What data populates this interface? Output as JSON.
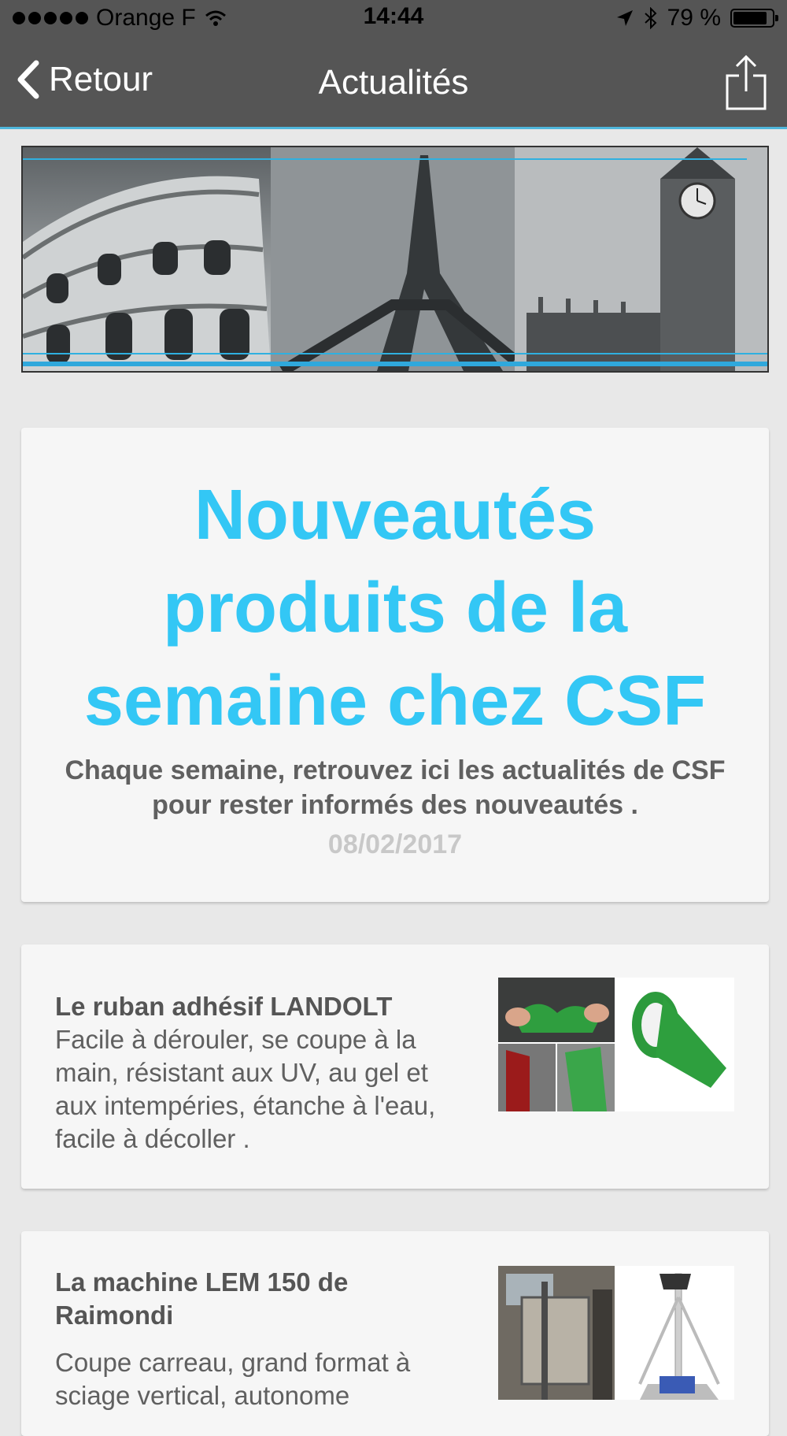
{
  "status_bar": {
    "carrier": "Orange F",
    "time": "14:44",
    "battery": "79 %"
  },
  "nav": {
    "back_label": "Retour",
    "title": "Actualités"
  },
  "hero": {
    "title": "Nouveautés produits de la semaine chez CSF",
    "description": "Chaque semaine, retrouvez ici les actualités de CSF pour rester informés des nouveautés .",
    "date": "08/02/2017"
  },
  "news": [
    {
      "title": "Le ruban adhésif LANDOLT",
      "text": "Facile à dérouler, se coupe à la main, résistant aux UV, au gel et aux intempéries, étanche à l'eau, facile à décoller ."
    },
    {
      "title": "La machine LEM 150 de Raimondi",
      "text": "Coupe carreau, grand format à sciage vertical, autonome"
    }
  ],
  "colors": {
    "accent": "#33c7f5",
    "bar": "#555555",
    "separator": "#4fb7dc"
  }
}
